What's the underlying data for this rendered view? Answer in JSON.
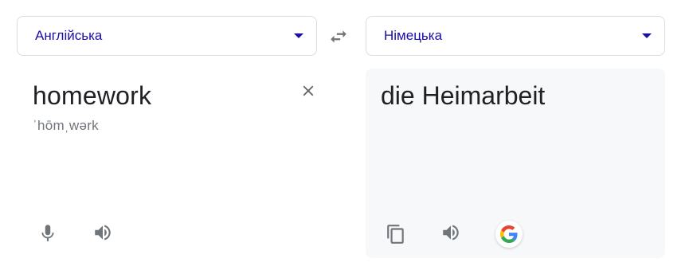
{
  "source_language": {
    "label": "Англійська"
  },
  "target_language": {
    "label": "Німецька"
  },
  "source": {
    "text": "homework",
    "phonetic": "ˈhōmˌwərk"
  },
  "target": {
    "text": "die Heimarbeit"
  },
  "colors": {
    "link": "#1a0dab",
    "icon": "#70757a",
    "text": "#202124",
    "target_panel_bg": "#f7f8f9"
  },
  "icons": {
    "dropdown": "chevron-down-icon",
    "swap": "swap-icon",
    "clear": "close-icon",
    "mic": "microphone-icon",
    "speaker": "speaker-icon",
    "copy": "copy-icon",
    "google": "google-logo"
  }
}
